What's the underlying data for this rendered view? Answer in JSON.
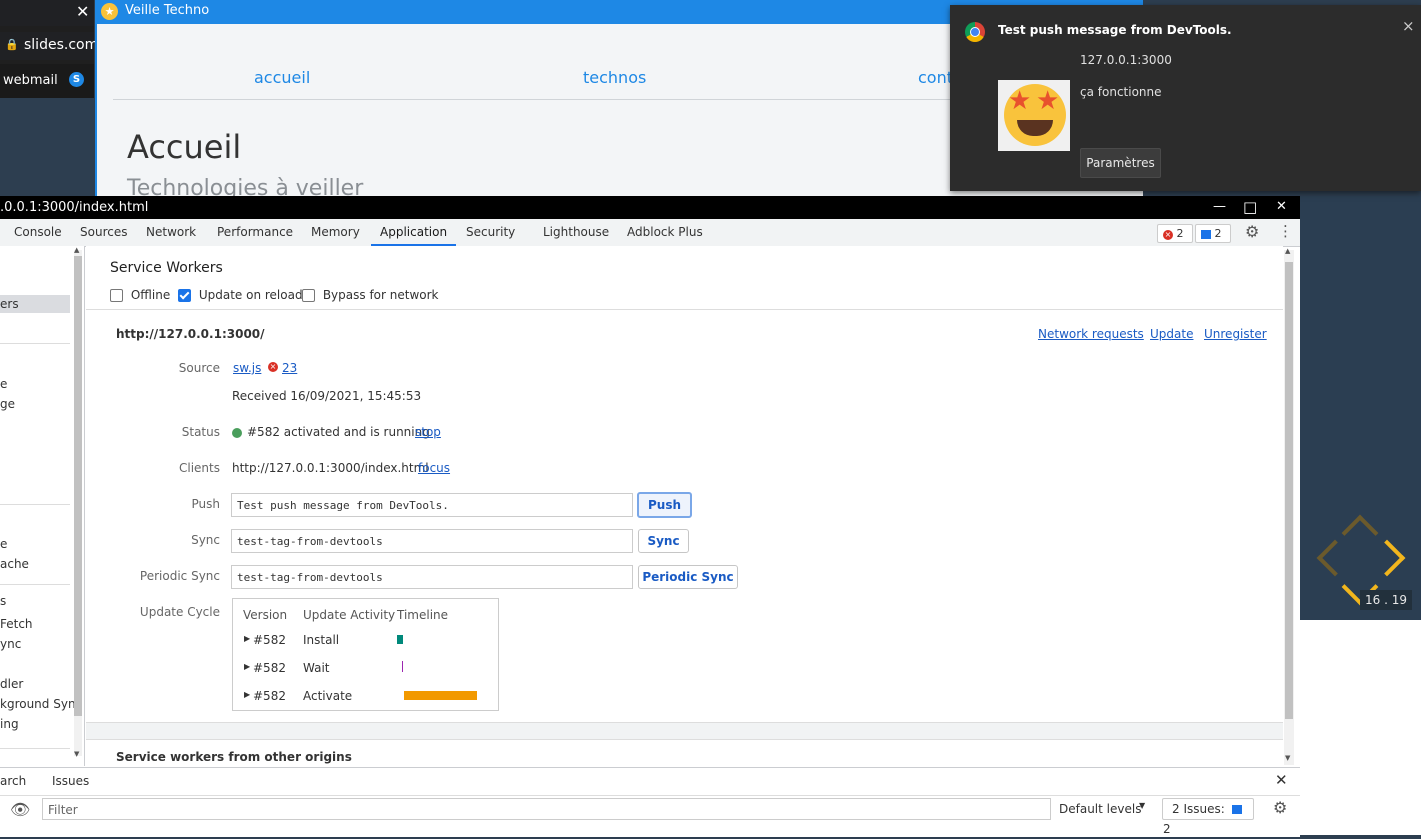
{
  "background": {
    "browser_url_fragment": "slides.com/",
    "bookmark": "webmail",
    "page_window": {
      "title": "Veille Techno",
      "nav": [
        "accueil",
        "technos",
        "conta"
      ],
      "heading": "Accueil",
      "subheading": "Technologies à veiller"
    },
    "slide_counter": "16 . 19"
  },
  "notification": {
    "title": "Test push message from DevTools.",
    "origin": "127.0.0.1:3000",
    "body": "ça fonctionne",
    "settings_button": "Paramètres",
    "close": "×"
  },
  "devtools": {
    "window_title": ".0.0.1:3000/index.html",
    "window_controls": {
      "minimize": "—",
      "maximize": "□",
      "close": "✕"
    },
    "tabs": [
      "Console",
      "Sources",
      "Network",
      "Performance",
      "Memory",
      "Application",
      "Security",
      "Lighthouse",
      "Adblock Plus"
    ],
    "active_tab": "Application",
    "error_count": "2",
    "message_count": "2",
    "sidebar_items": [
      "ers",
      "e",
      "ge",
      "e",
      "ache",
      "s",
      "Fetch",
      "ync",
      "dler",
      "kground Sync",
      "ing"
    ],
    "service_workers": {
      "title": "Service Workers",
      "options": [
        {
          "label": "Offline",
          "checked": false
        },
        {
          "label": "Update on reload",
          "checked": true
        },
        {
          "label": "Bypass for network",
          "checked": false
        }
      ],
      "scope": "http://127.0.0.1:3000/",
      "header_links": [
        "Network requests",
        "Update",
        "Unregister"
      ],
      "source_label": "Source",
      "source_file": "sw.js",
      "source_errors": "23",
      "received": "Received 16/09/2021, 15:45:53",
      "status_label": "Status",
      "status_text": "#582 activated and is running",
      "status_action": "stop",
      "clients_label": "Clients",
      "clients_url": "http://127.0.0.1:3000/index.html",
      "clients_action": "focus",
      "push_label": "Push",
      "push_value": "Test push message from DevTools.",
      "push_button": "Push",
      "sync_label": "Sync",
      "sync_value": "test-tag-from-devtools",
      "sync_button": "Sync",
      "periodic_label": "Periodic Sync",
      "periodic_value": "test-tag-from-devtools",
      "periodic_button": "Periodic Sync",
      "update_cycle_label": "Update Cycle",
      "update_cycle_headers": [
        "Version",
        "Update Activity",
        "Timeline"
      ],
      "update_cycle_rows": [
        {
          "version": "#582",
          "activity": "Install",
          "color": "#00897b"
        },
        {
          "version": "#582",
          "activity": "Wait",
          "color": "#9c27b0"
        },
        {
          "version": "#582",
          "activity": "Activate",
          "color": "#f29900"
        }
      ],
      "other_origins": "Service workers from other origins"
    },
    "drawer": {
      "tabs": [
        "arch",
        "Issues"
      ],
      "filter_placeholder": "Filter",
      "levels": "Default levels",
      "issues": "2 Issues:",
      "issues_count": "2"
    }
  }
}
